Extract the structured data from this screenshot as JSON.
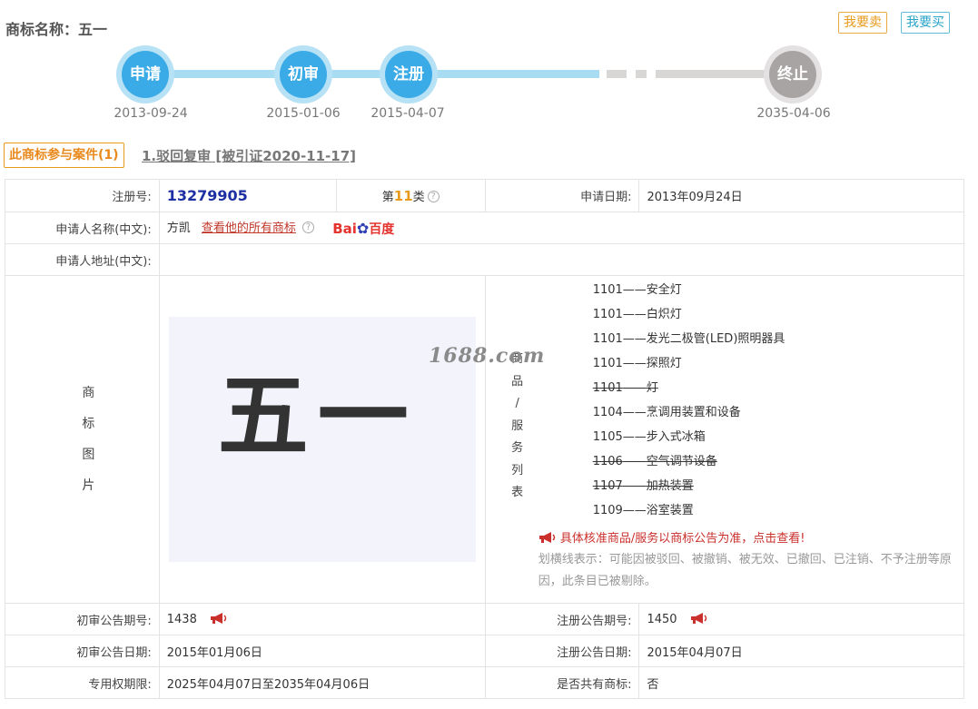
{
  "header": {
    "title": "商标名称：五一",
    "btn_sell": "我要卖",
    "btn_buy": "我要买"
  },
  "timeline": [
    {
      "label": "申请",
      "date": "2013-09-24"
    },
    {
      "label": "初审",
      "date": "2015-01-06"
    },
    {
      "label": "注册",
      "date": "2015-04-07"
    },
    {
      "label": "终止",
      "date": "2035-04-06"
    }
  ],
  "cases": {
    "tab": "此商标参与案件(1)",
    "link": "1.驳回复审 [被引证2020-11-17]"
  },
  "info": {
    "reg_no_label": "注册号:",
    "reg_no": "13279905",
    "class_prefix": "第",
    "class_num": "11",
    "class_suffix": "类",
    "apply_date_label": "申请日期:",
    "apply_date": "2013年09月24日",
    "applicant_label": "申请人名称(中文):",
    "applicant": "方凯",
    "view_all": "查看他的所有商标",
    "baidu_bai": "Bai",
    "baidu_du": "百度",
    "address_label": "申请人地址(中文):",
    "image_label": [
      "商",
      "标",
      "图",
      "片"
    ],
    "trademark_text": "五一",
    "watermark": "1688.com",
    "goods_label": [
      "商",
      "品",
      "/",
      "服",
      "务",
      "列",
      "表"
    ],
    "notice_red": "具体核准商品/服务以商标公告为准，点击查看!",
    "notice_gray": "划横线表示：可能因被驳回、被撤销、被无效、已撤回、已注销、不予注册等原因，此条目已被剔除。",
    "prelim_no_label": "初审公告期号:",
    "prelim_no": "1438",
    "reg_pub_no_label": "注册公告期号:",
    "reg_pub_no": "1450",
    "prelim_date_label": "初审公告日期:",
    "prelim_date": "2015年01月06日",
    "reg_pub_date_label": "注册公告日期:",
    "reg_pub_date": "2015年04月07日",
    "term_label": "专用权期限:",
    "term": "2025年04月07日至2035年04月06日",
    "shared_label": "是否共有商标:",
    "shared": "否"
  },
  "goods": [
    {
      "code": "1101",
      "name": "安全灯",
      "strike": false
    },
    {
      "code": "1101",
      "name": "白炽灯",
      "strike": false
    },
    {
      "code": "1101",
      "name": "发光二极管(LED)照明器具",
      "strike": false
    },
    {
      "code": "1101",
      "name": "探照灯",
      "strike": false
    },
    {
      "code": "1101",
      "name": "灯",
      "strike": true
    },
    {
      "code": "1104",
      "name": "烹调用装置和设备",
      "strike": false
    },
    {
      "code": "1105",
      "name": "步入式冰箱",
      "strike": false
    },
    {
      "code": "1106",
      "name": "空气调节设备",
      "strike": true
    },
    {
      "code": "1107",
      "name": "加热装置",
      "strike": true
    },
    {
      "code": "1109",
      "name": "浴室装置",
      "strike": false
    }
  ],
  "colors": {
    "accent_orange": "#e89a1c",
    "accent_blue": "#3aabe6",
    "regno_blue": "#1d2fa2",
    "notice_red": "#c9302c"
  }
}
